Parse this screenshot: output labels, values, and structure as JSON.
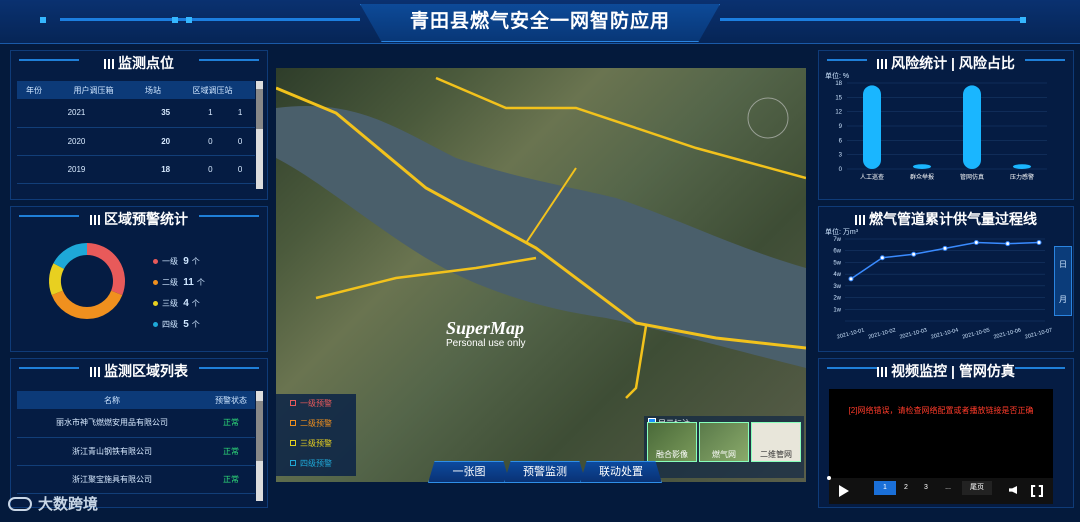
{
  "header": {
    "title": "青田县燃气安全一网智防应用"
  },
  "monitor": {
    "title": "监测点位",
    "columns": [
      "年份",
      "用户调压箱",
      "场站",
      "区域调压站"
    ],
    "rows": [
      [
        "2021",
        "35",
        "1",
        "1"
      ],
      [
        "2020",
        "20",
        "0",
        "0"
      ],
      [
        "2019",
        "18",
        "0",
        "0"
      ]
    ]
  },
  "warning": {
    "title": "区域预警统计",
    "items": [
      {
        "label": "一级",
        "count": "9",
        "unit": "个",
        "color": "#e85a5a"
      },
      {
        "label": "二级",
        "count": "11",
        "unit": "个",
        "color": "#f0901e"
      },
      {
        "label": "三级",
        "count": "4",
        "unit": "个",
        "color": "#e8d020"
      },
      {
        "label": "四级",
        "count": "5",
        "unit": "个",
        "color": "#1ea8d8"
      }
    ]
  },
  "area_list": {
    "title": "监测区域列表",
    "columns": [
      "名称",
      "预警状态"
    ],
    "rows": [
      [
        "丽水市神飞燃燃安用品有限公司",
        "正常"
      ],
      [
        "浙江青山钢铁有限公司",
        "正常"
      ],
      [
        "浙江聚宝施具有限公司",
        "正常"
      ]
    ]
  },
  "map": {
    "watermark": "SuperMap",
    "watermark_sub": "Personal use only",
    "legend": [
      "一级预警",
      "二级预警",
      "三级预警",
      "四级预警"
    ],
    "show_label": "显示标注",
    "thumbs": [
      "融合影像",
      "燃气网",
      "二维管网"
    ],
    "tabs": [
      "一张图",
      "预警监测",
      "联动处置"
    ]
  },
  "risk": {
    "title": "风险统计 | 风险占比",
    "unit": "单位: %",
    "chart_data": {
      "type": "bar",
      "categories": [
        "人工巡查",
        "群众举报",
        "管网仿真",
        "压力感警"
      ],
      "values": [
        17.5,
        1,
        17.5,
        1
      ],
      "ylim": [
        0,
        18
      ],
      "yticks": [
        "0",
        "3",
        "6",
        "9",
        "12",
        "15",
        "18"
      ],
      "color": "#1ab6ff"
    }
  },
  "supply": {
    "title": "燃气管道累计供气量过程线",
    "unit": "单位: 万m³",
    "chart_data": {
      "type": "line",
      "x": [
        "2021-10-01",
        "2021-10-02",
        "2021-10-03",
        "2021-10-04",
        "2021-10-05",
        "2021-10-06",
        "2021-10-07"
      ],
      "values": [
        3.6,
        5.4,
        5.7,
        6.2,
        6.7,
        6.6,
        6.7
      ],
      "ylim": [
        0,
        7
      ],
      "yticks": [
        "",
        "1w",
        "2w",
        "3w",
        "4w",
        "5w",
        "6w",
        "7w"
      ],
      "color": "#3a8bff"
    },
    "toggle": [
      "日",
      "月"
    ]
  },
  "video": {
    "title": "视频监控 | 管网仿真",
    "error": "[2]网络错误，请检查网络配置或者播放链接是否正确",
    "pages": [
      "1",
      "2",
      "3",
      "...",
      "尾页"
    ]
  },
  "brand": "大数跨境"
}
